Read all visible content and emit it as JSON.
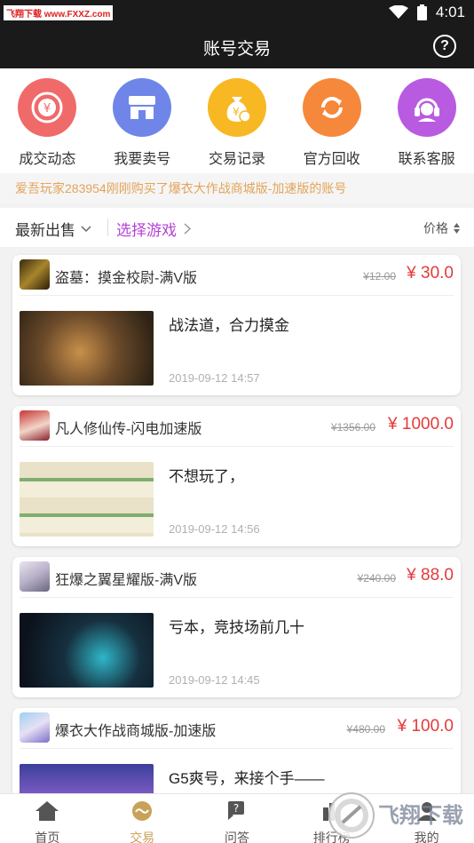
{
  "statusbar": {
    "watermark": "飞翔下载 www.FXXZ.com",
    "time": "4:01"
  },
  "header": {
    "title": "账号交易",
    "help": "?"
  },
  "quicknav": [
    {
      "label": "成交动态",
      "icon": "yen-exchange-icon",
      "color": "#f06a6a"
    },
    {
      "label": "我要卖号",
      "icon": "shop-icon",
      "color": "#6f86e8"
    },
    {
      "label": "交易记录",
      "icon": "money-bag-icon",
      "color": "#f7b824"
    },
    {
      "label": "官方回收",
      "icon": "recycle-icon",
      "color": "#f5883a"
    },
    {
      "label": "联系客服",
      "icon": "headset-icon",
      "color": "#b95be0"
    }
  ],
  "notice": "爱吾玩家283954刚刚购买了爆衣大作战商城版-加速版的账号",
  "filters": {
    "latest": "最新出售",
    "select_game": "选择游戏",
    "price": "价格"
  },
  "listings": [
    {
      "name": "盗墓：摸金校尉-满V版",
      "old_price": "¥12.00",
      "price": "¥ 30.0",
      "desc": "战法道，合力摸金",
      "time": "2019-09-12 14:57"
    },
    {
      "name": "凡人修仙传-闪电加速版",
      "old_price": "¥1356.00",
      "price": "¥ 1000.0",
      "desc": "不想玩了，",
      "time": "2019-09-12 14:56"
    },
    {
      "name": "狂爆之翼星耀版-满V版",
      "old_price": "¥240.00",
      "price": "¥ 88.0",
      "desc": "亏本，竞技场前几十",
      "time": "2019-09-12 14:45"
    },
    {
      "name": "爆衣大作战商城版-加速版",
      "old_price": "¥480.00",
      "price": "¥ 100.0",
      "desc": "G5爽号，来接个手——",
      "time": ""
    }
  ],
  "tabs": [
    {
      "label": "首页",
      "icon": "home-icon"
    },
    {
      "label": "交易",
      "icon": "trade-icon"
    },
    {
      "label": "问答",
      "icon": "qa-icon"
    },
    {
      "label": "排行榜",
      "icon": "ranking-icon"
    },
    {
      "label": "我的",
      "icon": "user-icon"
    }
  ],
  "brand_watermark": "飞翔下载",
  "colors": {
    "price": "#e43a3a",
    "accent": "#b443d6",
    "active_tab": "#c9a25a",
    "notice": "#e3a45a"
  }
}
